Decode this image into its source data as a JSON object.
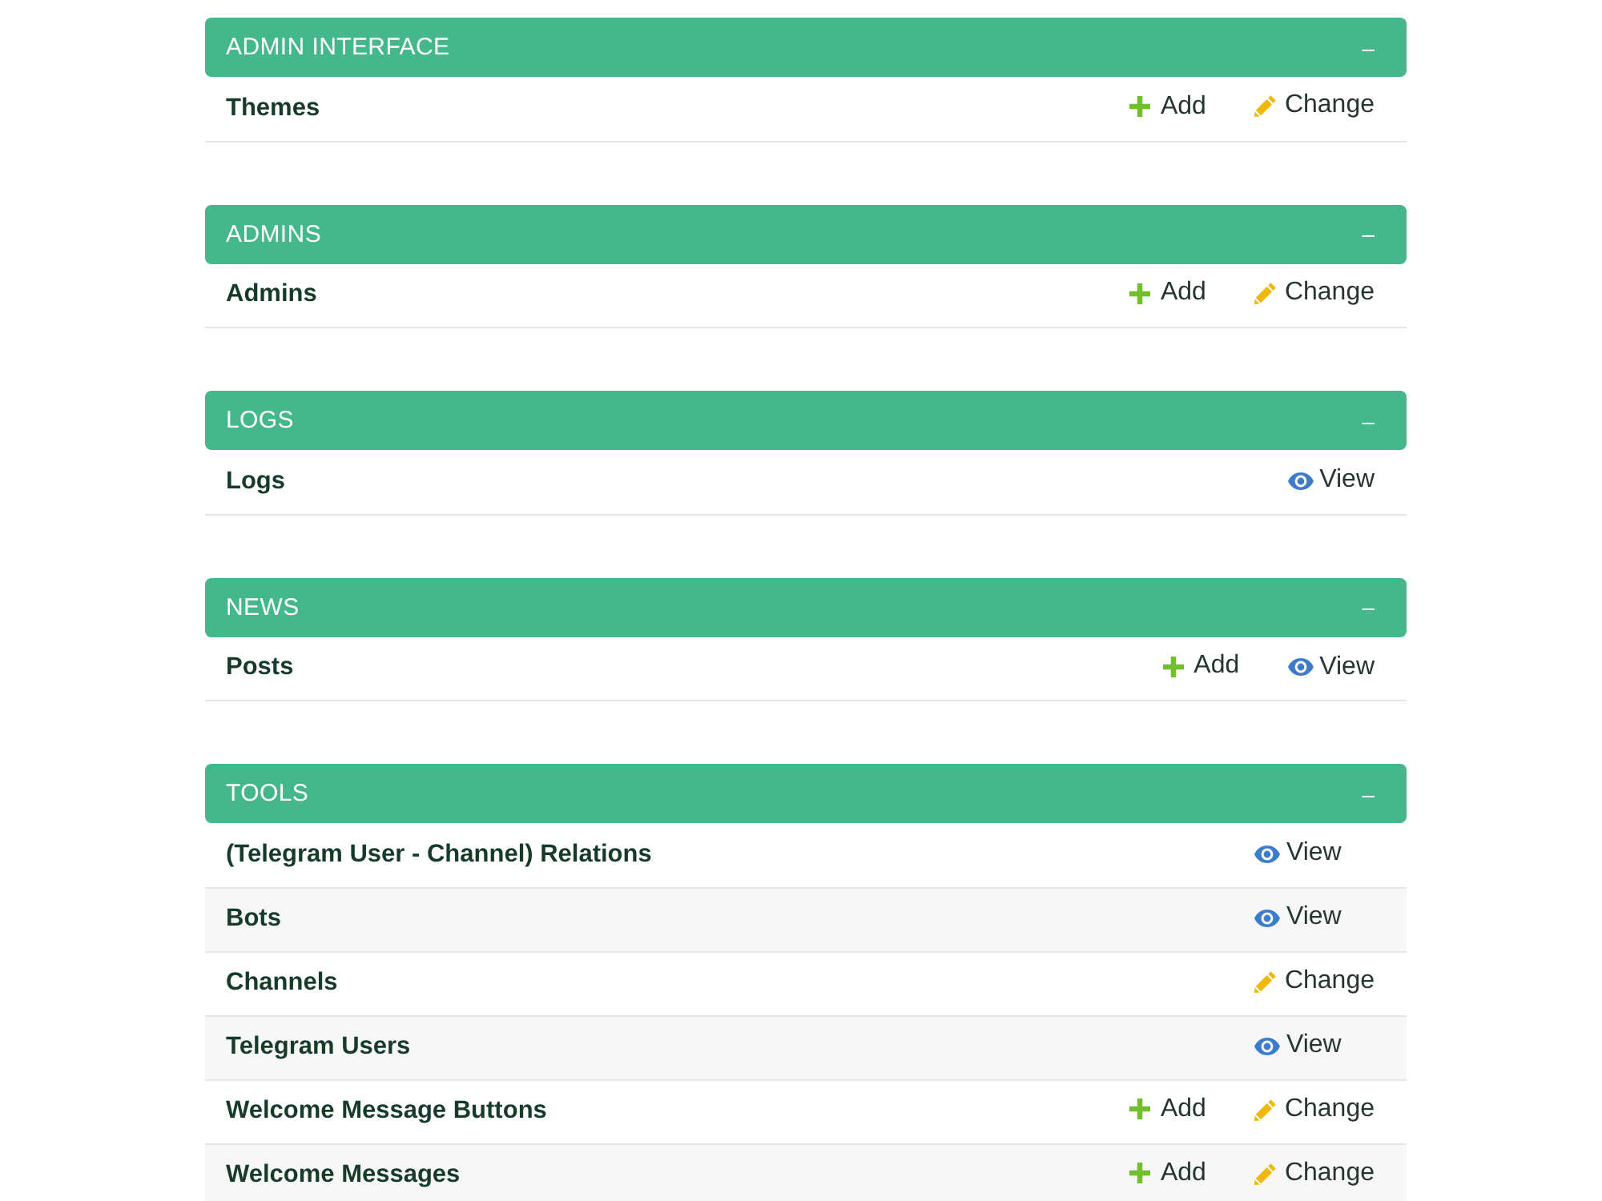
{
  "modules": [
    {
      "title": "ADMIN INTERFACE",
      "toggle": "–",
      "models": [
        {
          "name": "Themes",
          "add": {
            "label": "Add"
          },
          "admin": {
            "kind": "change",
            "label": "Change"
          }
        }
      ]
    },
    {
      "title": "ADMINS",
      "toggle": "–",
      "models": [
        {
          "name": "Admins",
          "add": {
            "label": "Add"
          },
          "admin": {
            "kind": "change",
            "label": "Change"
          }
        }
      ]
    },
    {
      "title": "LOGS",
      "toggle": "–",
      "models": [
        {
          "name": "Logs",
          "admin": {
            "kind": "view",
            "label": "View"
          }
        }
      ]
    },
    {
      "title": "NEWS",
      "toggle": "–",
      "models": [
        {
          "name": "Posts",
          "add": {
            "label": "Add"
          },
          "admin": {
            "kind": "view",
            "label": "View"
          }
        }
      ]
    },
    {
      "title": "TOOLS",
      "toggle": "–",
      "models": [
        {
          "name": "(Telegram User - Channel) Relations",
          "admin": {
            "kind": "view",
            "label": "View"
          }
        },
        {
          "name": "Bots",
          "admin": {
            "kind": "view",
            "label": "View"
          }
        },
        {
          "name": "Channels",
          "admin": {
            "kind": "change",
            "label": "Change"
          }
        },
        {
          "name": "Telegram Users",
          "admin": {
            "kind": "view",
            "label": "View"
          }
        },
        {
          "name": "Welcome Message Buttons",
          "add": {
            "label": "Add"
          },
          "admin": {
            "kind": "change",
            "label": "Change"
          }
        },
        {
          "name": "Welcome Messages",
          "add": {
            "label": "Add"
          },
          "admin": {
            "kind": "change",
            "label": "Change"
          }
        }
      ]
    }
  ]
}
